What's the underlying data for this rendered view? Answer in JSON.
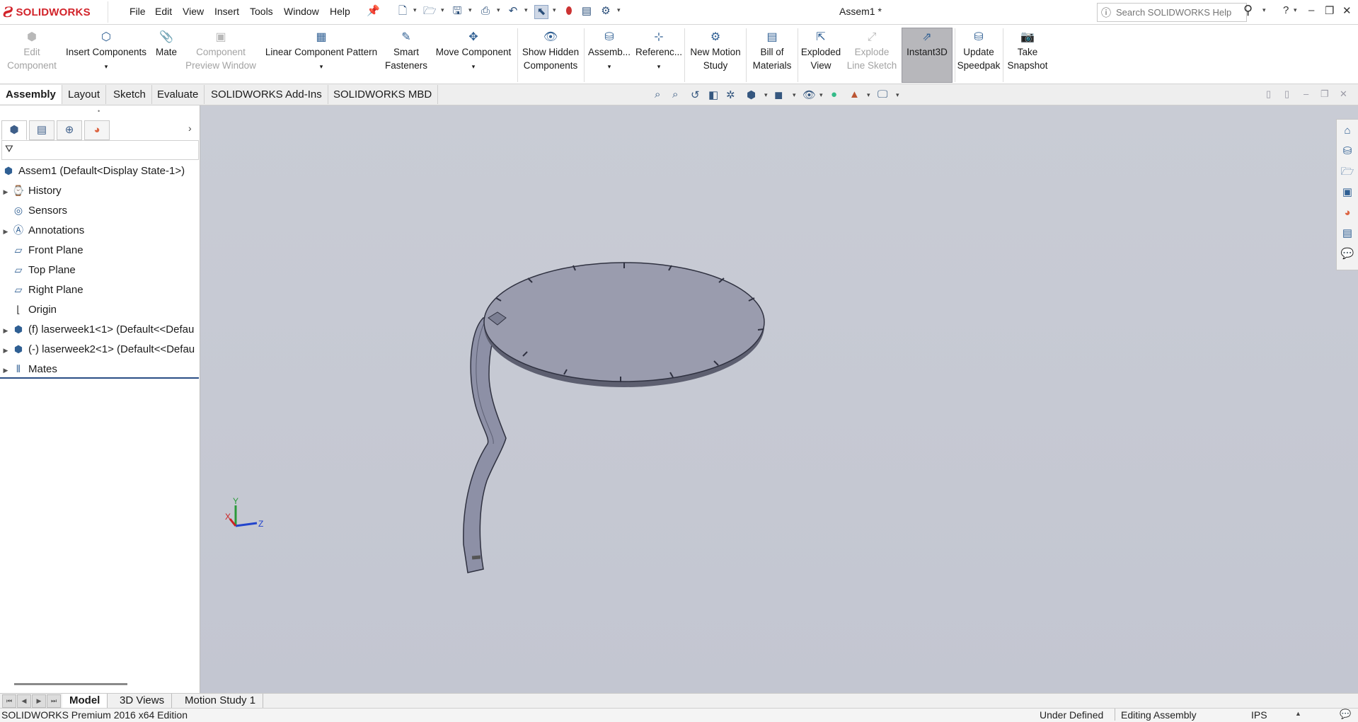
{
  "app": {
    "name": "SOLIDWORKS",
    "logo_mark": "3S",
    "doc_title": "Assem1 *"
  },
  "menu": [
    "File",
    "Edit",
    "View",
    "Insert",
    "Tools",
    "Window",
    "Help"
  ],
  "search": {
    "placeholder": "Search SOLIDWORKS Help"
  },
  "commands": {
    "edit_component": "Edit\nComponent",
    "insert_components": "Insert Components",
    "mate": "Mate",
    "component_preview": "Component\nPreview Window",
    "linear_pattern": "Linear Component Pattern",
    "smart_fasteners": "Smart\nFasteners",
    "move_component": "Move Component",
    "show_hidden": "Show Hidden\nComponents",
    "assembly": "Assemb...",
    "reference": "Referenc...",
    "new_motion": "New Motion\nStudy",
    "bom": "Bill of\nMaterials",
    "exploded": "Exploded\nView",
    "explode_line": "Explode\nLine Sketch",
    "instant3d": "Instant3D",
    "update_speedpak": "Update\nSpeedpak",
    "take_snapshot": "Take\nSnapshot"
  },
  "tabs": [
    "Assembly",
    "Layout",
    "Sketch",
    "Evaluate",
    "SOLIDWORKS Add-Ins",
    "SOLIDWORKS MBD"
  ],
  "tree": {
    "root": "Assem1  (Default<Display State-1>)",
    "items": [
      {
        "label": "History",
        "icon": "history-icon",
        "expandable": true
      },
      {
        "label": "Sensors",
        "icon": "sensors-icon",
        "expandable": false
      },
      {
        "label": "Annotations",
        "icon": "annotations-icon",
        "expandable": true
      },
      {
        "label": "Front Plane",
        "icon": "plane-icon",
        "expandable": false
      },
      {
        "label": "Top Plane",
        "icon": "plane-icon",
        "expandable": false
      },
      {
        "label": "Right Plane",
        "icon": "plane-icon",
        "expandable": false
      },
      {
        "label": "Origin",
        "icon": "origin-icon",
        "expandable": false
      },
      {
        "label": "(f) laserweek1<1> (Default<<Defau",
        "icon": "part-icon",
        "expandable": true
      },
      {
        "label": "(-) laserweek2<1> (Default<<Defau",
        "icon": "part-icon",
        "expandable": true
      },
      {
        "label": "Mates",
        "icon": "mates-icon",
        "expandable": true
      }
    ]
  },
  "triad": {
    "x": "X",
    "y": "Y",
    "z": "Z"
  },
  "bottom_tabs": [
    "Model",
    "3D Views",
    "Motion Study 1"
  ],
  "status": {
    "edition": "SOLIDWORKS Premium 2016 x64 Edition",
    "defined": "Under Defined",
    "mode": "Editing Assembly",
    "units": "IPS"
  },
  "colors": {
    "brand_red": "#d2232a",
    "viewport_bg": "#c6c9d3",
    "model_fill": "#9a9cae",
    "model_edge": "#3a3c4a"
  }
}
